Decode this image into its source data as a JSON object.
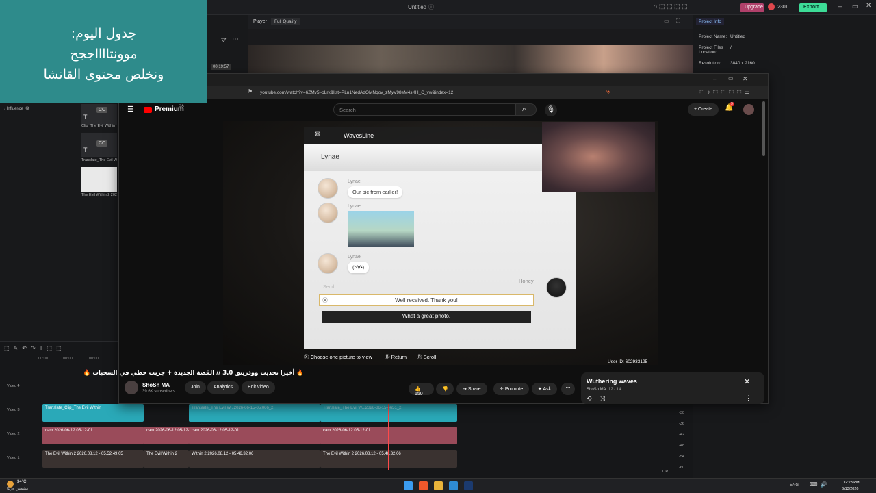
{
  "editor": {
    "title": "Untitled",
    "upgrade_label": "Upgrade",
    "credits": "2301",
    "export_label": "Export",
    "player_label": "Player",
    "quality": "Full Quality",
    "timecode": "00:19:57",
    "influence_kit": "Influence Kit",
    "media": [
      {
        "name": "Clip_The Evil Within"
      },
      {
        "name": "Translate_The Evil W..."
      },
      {
        "name": "The Evil Within 2 2026..."
      }
    ],
    "project_info": {
      "tab": "Project Info",
      "name_label": "Project Name:",
      "name_value": "Untitled",
      "files_label": "Project Files Location:",
      "files_value": "/",
      "resolution_label": "Resolution:",
      "resolution_value": "3840 x 2160"
    },
    "tracks": [
      {
        "label": "Video 4"
      },
      {
        "label": "Video 3",
        "clips": [
          "Translate_Clip_The Evil Within",
          "Translate_The Evil W...2026-06-15-05:006_2",
          "Translate_The Evil W...2026-06-15-4651_2"
        ]
      },
      {
        "label": "Video 2",
        "clips": [
          "cam 2026-06-12 05-12-01",
          "cam 2026-06-12 05-12-01",
          "cam 2026-06-12 05-12-01",
          "cam 2026-06-12 05-12-01"
        ]
      },
      {
        "label": "Video 1",
        "clips": [
          "The Evil Within 2 2026.08.12 - 05.52.49.05",
          "The Evil Within 2",
          "Within 2 2026.08.12 - 05.46.32.06",
          "The Evil Within 2 2026.08.12 - 05.46.32.06"
        ]
      }
    ],
    "ruler": [
      "00:00",
      "00:00",
      "00:00"
    ],
    "meter": [
      "-30",
      "-36",
      "-42",
      "-48",
      "-54",
      "-60"
    ],
    "meter_lr": "L  R"
  },
  "overlay": {
    "line1": "جدول اليوم:",
    "line2": "موونتااااججج",
    "line3": "ونخلص محتوى القاتشا"
  },
  "browser": {
    "url": "youtube.com/watch?v=6ZMv5i-oLrk&list=PLn1NedAdOMNqov_zMyV98eM4sKH_C_vw&index=12",
    "premium": "Premium",
    "premium_sup": "SA",
    "search_placeholder": "Search",
    "create_label": "Create",
    "notif_count": "9"
  },
  "chat": {
    "app": "WavesLine",
    "contact": "Lynae",
    "messages": [
      {
        "sender": "Lynae",
        "text": "Our pic from earlier!"
      },
      {
        "sender": "Lynae",
        "text": ""
      },
      {
        "sender": "Lynae",
        "text": "(>∀•)"
      }
    ],
    "me": "Honey",
    "send_label": "Send",
    "reply_1": "Well received. Thank you!",
    "reply_2": "What a great photo.",
    "hints": {
      "choose": "Choose one picture to view",
      "return": "Return",
      "scroll": "Scroll"
    },
    "user_id": "User ID: 602933195"
  },
  "video": {
    "title": "🔥 أخيرا تحديث ووذرينق 3.0 // القصة الجديدة + جربت حظي في السحبات 🔥",
    "channel": "ShoSh MA",
    "subscribers": "39.6K subscribers",
    "join": "Join",
    "analytics": "Analytics",
    "edit": "Edit video",
    "likes": "150",
    "share": "Share",
    "promote": "Promote",
    "ask": "Ask"
  },
  "playlist": {
    "title": "Wuthering waves",
    "channel": "ShoSh MA",
    "position": "12 / 14"
  },
  "taskbar": {
    "temp": "34°C",
    "weather": "مشمس جزئيًا",
    "lang": "ENG",
    "time": "12:23 PM",
    "date": "6/13/2026"
  },
  "colors": {
    "overlay_teal": "#2e8b8b",
    "yt_red": "#ff0000",
    "export_green": "#3ddc97",
    "track_teal": "#2aa9b8",
    "track_pink": "#9a4b5a"
  }
}
